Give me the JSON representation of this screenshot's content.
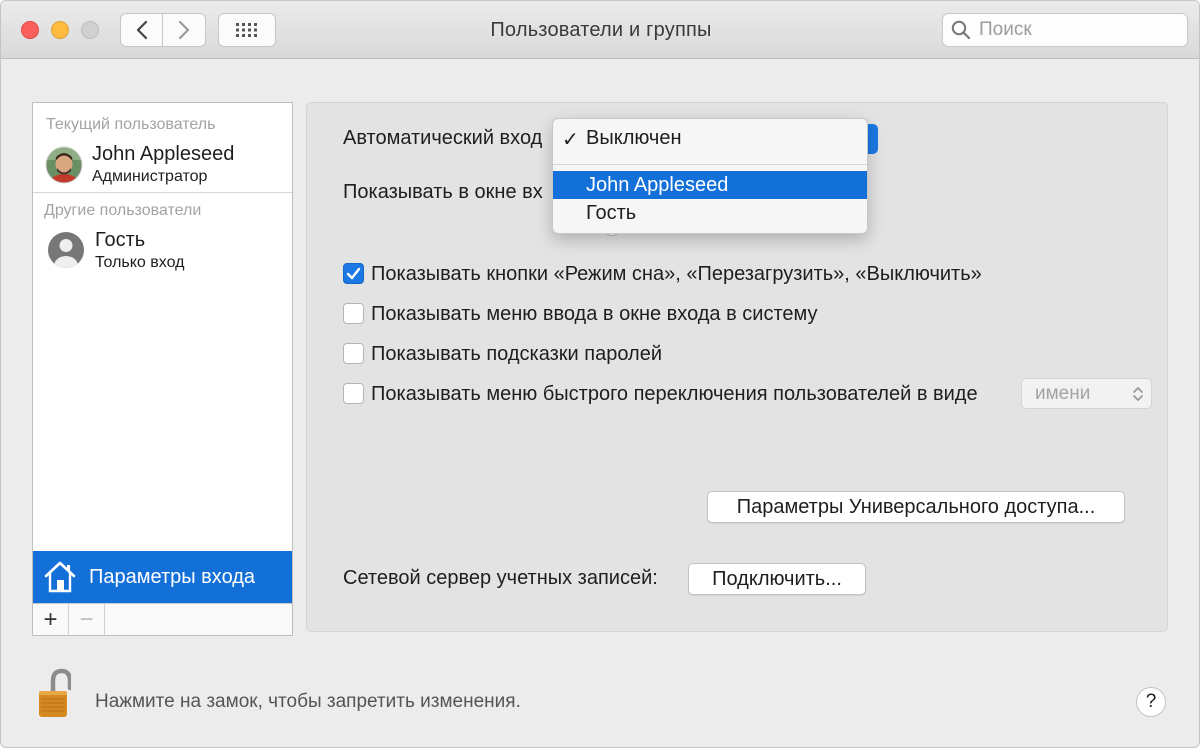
{
  "window": {
    "title": "Пользователи и группы",
    "search_placeholder": "Поиск"
  },
  "sidebar": {
    "current_user_label": "Текущий пользователь",
    "current_user": {
      "name": "John Appleseed",
      "role": "Администратор"
    },
    "other_users_label": "Другие пользователи",
    "other_users": [
      {
        "name": "Гость",
        "role": "Только вход"
      }
    ],
    "login_options": "Параметры входа",
    "add_button": "+",
    "remove_button": "−"
  },
  "main": {
    "auto_login_label": "Автоматический вход",
    "show_in_window_label": "Показывать в окне вх",
    "dropdown": {
      "items": [
        {
          "label": "Выключен",
          "checked": true
        },
        {
          "label": "John Appleseed",
          "highlighted": true
        },
        {
          "label": "Гость"
        }
      ]
    },
    "checkboxes": [
      {
        "label": "Показывать кнопки «Режим сна», «Перезагрузить», «Выключить»",
        "checked": true
      },
      {
        "label": "Показывать меню ввода в окне входа в систему",
        "checked": false
      },
      {
        "label": "Показывать подсказки паролей",
        "checked": false
      },
      {
        "label": "Показывать меню быстрого переключения пользователей в виде",
        "checked": false
      }
    ],
    "fast_switch_select": "имени",
    "accessibility_button": "Параметры Универсального доступа...",
    "network_server_label": "Сетевой сервер учетных записей:",
    "connect_button": "Подключить..."
  },
  "footer": {
    "lock_text": "Нажмите на замок, чтобы запретить изменения.",
    "help": "?"
  },
  "colors": {
    "accent": "#1470d9",
    "checkbox_checked": "#1c78e4"
  }
}
